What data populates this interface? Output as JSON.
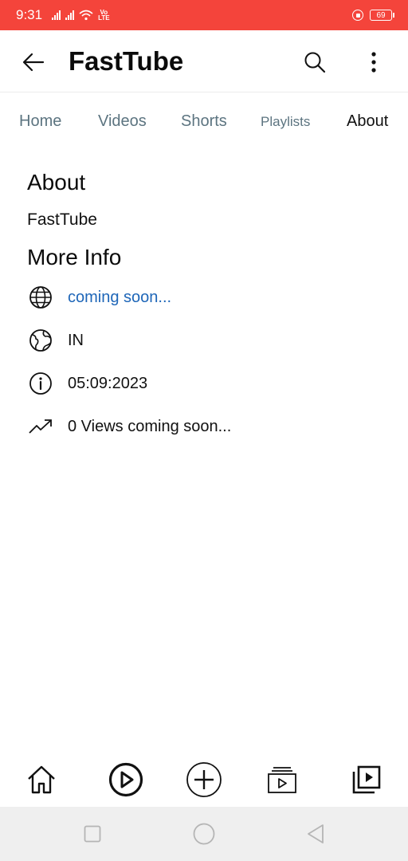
{
  "status_bar": {
    "time": "9:31",
    "network_label_top": "Vo",
    "network_label_bottom": "LTE",
    "battery": "69"
  },
  "app_bar": {
    "title": "FastTube"
  },
  "tabs": [
    {
      "label": "Home",
      "active": false
    },
    {
      "label": "Videos",
      "active": false
    },
    {
      "label": "Shorts",
      "active": false
    },
    {
      "label": "Playlists",
      "active": false
    },
    {
      "label": "About",
      "active": true
    }
  ],
  "about": {
    "heading": "About",
    "channel_name": "FastTube"
  },
  "more_info": {
    "heading": "More Info",
    "rows": [
      {
        "icon": "globe-icon",
        "text": "coming soon..."
      },
      {
        "icon": "earth-icon",
        "text": "IN"
      },
      {
        "icon": "info-icon",
        "text": "05:09:2023"
      },
      {
        "icon": "trending-icon",
        "text": "0 Views coming soon..."
      }
    ]
  },
  "bottom_nav": [
    {
      "icon": "home-icon"
    },
    {
      "icon": "play-circle-icon"
    },
    {
      "icon": "add-circle-icon"
    },
    {
      "icon": "subscriptions-icon"
    },
    {
      "icon": "library-icon"
    }
  ],
  "system_nav": [
    {
      "icon": "recents-square-icon"
    },
    {
      "icon": "home-circle-icon"
    },
    {
      "icon": "back-triangle-icon"
    }
  ],
  "colors": {
    "status_bar": "#f4443b",
    "link": "#1e66b8",
    "tab_inactive": "#5c7480"
  }
}
